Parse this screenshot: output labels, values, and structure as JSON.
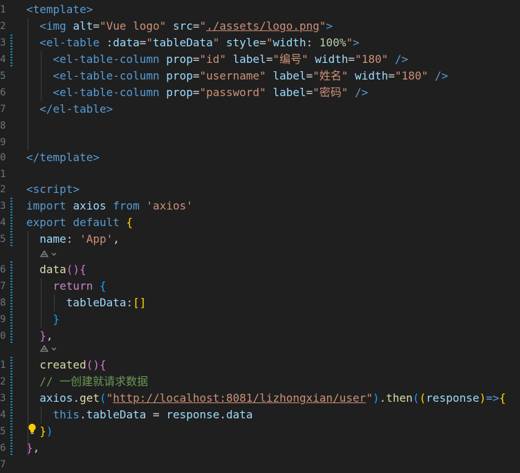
{
  "editor": {
    "lines": [
      {
        "n": "1",
        "t": [
          {
            "c": "tag",
            "v": "<template>"
          }
        ]
      },
      {
        "n": "2",
        "t": [
          {
            "c": "plain",
            "v": "  "
          },
          {
            "c": "tag",
            "v": "<img "
          },
          {
            "c": "attr",
            "v": "alt"
          },
          {
            "c": "punc",
            "v": "="
          },
          {
            "c": "str",
            "v": "\"Vue logo\""
          },
          {
            "c": "plain",
            "v": " "
          },
          {
            "c": "attr",
            "v": "src"
          },
          {
            "c": "punc",
            "v": "="
          },
          {
            "c": "str",
            "v": "\""
          },
          {
            "c": "link",
            "v": "./assets/logo.png"
          },
          {
            "c": "str",
            "v": "\""
          },
          {
            "c": "tag",
            "v": ">"
          }
        ]
      },
      {
        "n": "3",
        "t": [
          {
            "c": "plain",
            "v": "  "
          },
          {
            "c": "tag",
            "v": "<el-table "
          },
          {
            "c": "attr",
            "v": ":data"
          },
          {
            "c": "punc",
            "v": "="
          },
          {
            "c": "str",
            "v": "\""
          },
          {
            "c": "var",
            "v": "tableData"
          },
          {
            "c": "str",
            "v": "\""
          },
          {
            "c": "plain",
            "v": " "
          },
          {
            "c": "attr",
            "v": "style"
          },
          {
            "c": "punc",
            "v": "="
          },
          {
            "c": "str",
            "v": "\""
          },
          {
            "c": "var",
            "v": "width"
          },
          {
            "c": "plain",
            "v": ": "
          },
          {
            "c": "num",
            "v": "100%"
          },
          {
            "c": "str",
            "v": "\""
          },
          {
            "c": "tag",
            "v": ">"
          }
        ]
      },
      {
        "n": "4",
        "t": [
          {
            "c": "plain",
            "v": "    "
          },
          {
            "c": "tag",
            "v": "<el-table-column "
          },
          {
            "c": "attr",
            "v": "prop"
          },
          {
            "c": "punc",
            "v": "="
          },
          {
            "c": "str",
            "v": "\"id\""
          },
          {
            "c": "plain",
            "v": " "
          },
          {
            "c": "attr",
            "v": "label"
          },
          {
            "c": "punc",
            "v": "="
          },
          {
            "c": "str",
            "v": "\"编号\""
          },
          {
            "c": "plain",
            "v": " "
          },
          {
            "c": "attr",
            "v": "width"
          },
          {
            "c": "punc",
            "v": "="
          },
          {
            "c": "str",
            "v": "\"180\""
          },
          {
            "c": "plain",
            "v": " "
          },
          {
            "c": "tag",
            "v": "/>"
          }
        ]
      },
      {
        "n": "5",
        "t": [
          {
            "c": "plain",
            "v": "    "
          },
          {
            "c": "tag",
            "v": "<el-table-column "
          },
          {
            "c": "attr",
            "v": "prop"
          },
          {
            "c": "punc",
            "v": "="
          },
          {
            "c": "str",
            "v": "\"username\""
          },
          {
            "c": "plain",
            "v": " "
          },
          {
            "c": "attr",
            "v": "label"
          },
          {
            "c": "punc",
            "v": "="
          },
          {
            "c": "str",
            "v": "\"姓名\""
          },
          {
            "c": "plain",
            "v": " "
          },
          {
            "c": "attr",
            "v": "width"
          },
          {
            "c": "punc",
            "v": "="
          },
          {
            "c": "str",
            "v": "\"180\""
          },
          {
            "c": "plain",
            "v": " "
          },
          {
            "c": "tag",
            "v": "/>"
          }
        ]
      },
      {
        "n": "6",
        "t": [
          {
            "c": "plain",
            "v": "    "
          },
          {
            "c": "tag",
            "v": "<el-table-column "
          },
          {
            "c": "attr",
            "v": "prop"
          },
          {
            "c": "punc",
            "v": "="
          },
          {
            "c": "str",
            "v": "\"password\""
          },
          {
            "c": "plain",
            "v": " "
          },
          {
            "c": "attr",
            "v": "label"
          },
          {
            "c": "punc",
            "v": "="
          },
          {
            "c": "str",
            "v": "\"密码\""
          },
          {
            "c": "plain",
            "v": " "
          },
          {
            "c": "tag",
            "v": "/>"
          }
        ]
      },
      {
        "n": "7",
        "t": [
          {
            "c": "plain",
            "v": "  "
          },
          {
            "c": "tag",
            "v": "</el-table>"
          }
        ]
      },
      {
        "n": "8",
        "t": []
      },
      {
        "n": "9",
        "t": []
      },
      {
        "n": "0",
        "t": [
          {
            "c": "tag",
            "v": "</template>"
          }
        ]
      },
      {
        "n": "1",
        "t": []
      },
      {
        "n": "2",
        "t": [
          {
            "c": "tag",
            "v": "<script>"
          }
        ]
      },
      {
        "n": "3",
        "t": [
          {
            "c": "kw",
            "v": "import"
          },
          {
            "c": "plain",
            "v": " "
          },
          {
            "c": "var",
            "v": "axios"
          },
          {
            "c": "plain",
            "v": " "
          },
          {
            "c": "kw",
            "v": "from"
          },
          {
            "c": "plain",
            "v": " "
          },
          {
            "c": "str",
            "v": "'axios'"
          }
        ]
      },
      {
        "n": "4",
        "t": [
          {
            "c": "kw",
            "v": "export"
          },
          {
            "c": "plain",
            "v": " "
          },
          {
            "c": "kw",
            "v": "default"
          },
          {
            "c": "plain",
            "v": " "
          },
          {
            "c": "brace1",
            "v": "{"
          }
        ]
      },
      {
        "n": "5",
        "t": [
          {
            "c": "plain",
            "v": "  "
          },
          {
            "c": "var",
            "v": "name"
          },
          {
            "c": "plain",
            "v": ": "
          },
          {
            "c": "str",
            "v": "'App'"
          },
          {
            "c": "plain",
            "v": ","
          }
        ]
      },
      {
        "n": "6",
        "t": [
          {
            "c": "plain",
            "v": "  "
          },
          {
            "c": "fn",
            "v": "data"
          },
          {
            "c": "brace2",
            "v": "()"
          },
          {
            "c": "brace2",
            "v": "{"
          }
        ]
      },
      {
        "n": "7",
        "t": [
          {
            "c": "plain",
            "v": "    "
          },
          {
            "c": "kw2",
            "v": "return"
          },
          {
            "c": "plain",
            "v": " "
          },
          {
            "c": "brace3",
            "v": "{"
          }
        ]
      },
      {
        "n": "8",
        "t": [
          {
            "c": "plain",
            "v": "      "
          },
          {
            "c": "var",
            "v": "tableData"
          },
          {
            "c": "plain",
            "v": ":"
          },
          {
            "c": "brace1",
            "v": "[]"
          }
        ]
      },
      {
        "n": "9",
        "t": [
          {
            "c": "plain",
            "v": "    "
          },
          {
            "c": "brace3",
            "v": "}"
          }
        ]
      },
      {
        "n": "0",
        "t": [
          {
            "c": "plain",
            "v": "  "
          },
          {
            "c": "brace2",
            "v": "}"
          },
          {
            "c": "plain",
            "v": ","
          }
        ]
      },
      {
        "n": "1",
        "t": [
          {
            "c": "plain",
            "v": "  "
          },
          {
            "c": "fn",
            "v": "created"
          },
          {
            "c": "brace2",
            "v": "()"
          },
          {
            "c": "brace2",
            "v": "{"
          }
        ]
      },
      {
        "n": "2",
        "t": [
          {
            "c": "plain",
            "v": "  "
          },
          {
            "c": "comment",
            "v": "// 一创建就请求数据"
          }
        ]
      },
      {
        "n": "3",
        "t": [
          {
            "c": "plain",
            "v": "  "
          },
          {
            "c": "var",
            "v": "axios"
          },
          {
            "c": "plain",
            "v": "."
          },
          {
            "c": "fn",
            "v": "get"
          },
          {
            "c": "brace3",
            "v": "("
          },
          {
            "c": "str",
            "v": "\""
          },
          {
            "c": "link",
            "v": "http://localhost:8081/lizhongxian/user"
          },
          {
            "c": "str",
            "v": "\""
          },
          {
            "c": "brace3",
            "v": ")"
          },
          {
            "c": "plain",
            "v": "."
          },
          {
            "c": "fn",
            "v": "then"
          },
          {
            "c": "brace3",
            "v": "("
          },
          {
            "c": "brace1",
            "v": "("
          },
          {
            "c": "var",
            "v": "response"
          },
          {
            "c": "brace1",
            "v": ")"
          },
          {
            "c": "kw",
            "v": "=>"
          },
          {
            "c": "brace1",
            "v": "{"
          }
        ]
      },
      {
        "n": "4",
        "t": [
          {
            "c": "plain",
            "v": "    "
          },
          {
            "c": "kw",
            "v": "this"
          },
          {
            "c": "plain",
            "v": "."
          },
          {
            "c": "var",
            "v": "tableData"
          },
          {
            "c": "plain",
            "v": " = "
          },
          {
            "c": "var",
            "v": "response"
          },
          {
            "c": "plain",
            "v": "."
          },
          {
            "c": "var",
            "v": "data"
          }
        ]
      },
      {
        "n": "5",
        "t": [
          {
            "c": "plain",
            "v": "  "
          },
          {
            "c": "brace1",
            "v": "}"
          },
          {
            "c": "brace3",
            "v": ")"
          }
        ]
      },
      {
        "n": "6",
        "t": [
          {
            "c": "brace2",
            "v": "}"
          },
          {
            "c": "plain",
            "v": ","
          }
        ]
      },
      {
        "n": "7",
        "t": []
      }
    ],
    "colors": {
      "tag": "#569cd6",
      "attr": "#9cdcfe",
      "var": "#9cdcfe",
      "str": "#ce9178",
      "link": "#ce9178",
      "num": "#b5cea8",
      "punc": "#cccccc",
      "plain": "#cccccc",
      "kw": "#569cd6",
      "kw2": "#c586c0",
      "fn": "#dcdcaa",
      "comment": "#6a9955",
      "brace1": "#ffd700",
      "brace2": "#da70d6",
      "brace3": "#179fff",
      "background": "#1f1f1f",
      "line_number": "#6e7681"
    },
    "codelens_icon": "copilot-icon",
    "lightbulb_icon": "lightbulb-icon"
  }
}
